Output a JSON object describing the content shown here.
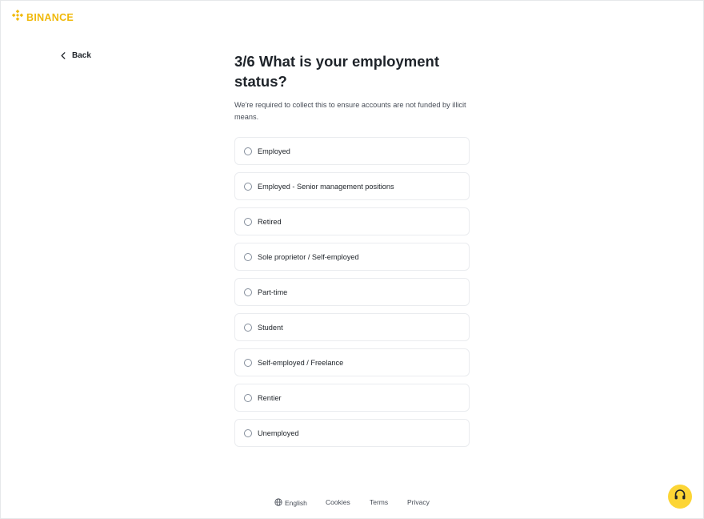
{
  "brand": {
    "name": "BINANCE",
    "color": "#F0B90B"
  },
  "nav": {
    "back_label": "Back",
    "back_icon": "chevron-left-icon"
  },
  "question": {
    "title": "3/6 What is your employment status?",
    "subtitle": "We're required to collect this to ensure accounts are not funded by illicit means."
  },
  "options": [
    {
      "label": "Employed",
      "selected": false
    },
    {
      "label": "Employed - Senior management positions",
      "selected": false
    },
    {
      "label": "Retired",
      "selected": false
    },
    {
      "label": "Sole proprietor / Self-employed",
      "selected": false
    },
    {
      "label": "Part-time",
      "selected": false
    },
    {
      "label": "Student",
      "selected": false
    },
    {
      "label": "Self-employed / Freelance",
      "selected": false
    },
    {
      "label": "Rentier",
      "selected": false
    },
    {
      "label": "Unemployed",
      "selected": false
    }
  ],
  "footer": {
    "language": "English",
    "language_icon": "globe-icon",
    "cookies": "Cookies",
    "terms": "Terms",
    "privacy": "Privacy"
  },
  "support": {
    "icon": "headset-icon",
    "color": "#FCD535"
  }
}
